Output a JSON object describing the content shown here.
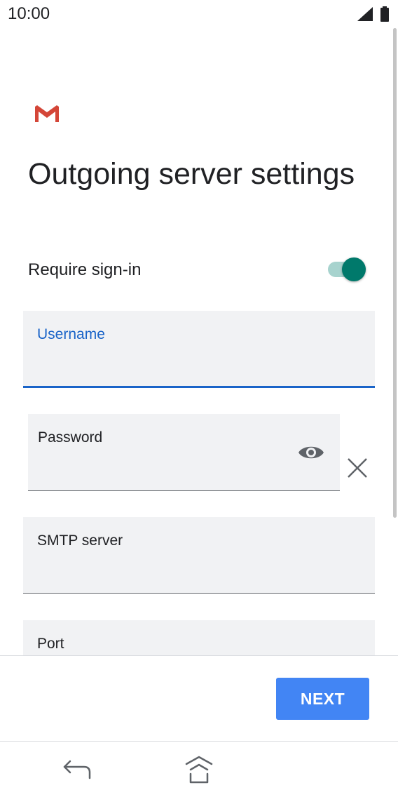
{
  "status_bar": {
    "time": "10:00",
    "icons": [
      "signal-icon",
      "battery-icon"
    ]
  },
  "app": {
    "logo": "gmail-icon"
  },
  "page": {
    "title": "Outgoing server settings"
  },
  "require_sign_in": {
    "label": "Require sign-in",
    "enabled": true,
    "accent_color": "#00796b"
  },
  "fields": {
    "username": {
      "label": "Username",
      "value": "",
      "focused": true,
      "focus_color": "#1a64c8"
    },
    "password": {
      "label": "Password",
      "value": "",
      "icons": [
        "eye-icon",
        "clear-icon"
      ]
    },
    "smtp_server": {
      "label": "SMTP server",
      "value": ""
    },
    "port": {
      "label": "Port",
      "value": ""
    }
  },
  "footer": {
    "next_label": "NEXT",
    "button_color": "#4285f4"
  },
  "nav_bar": {
    "icons": [
      "back-icon",
      "home-icon"
    ]
  }
}
